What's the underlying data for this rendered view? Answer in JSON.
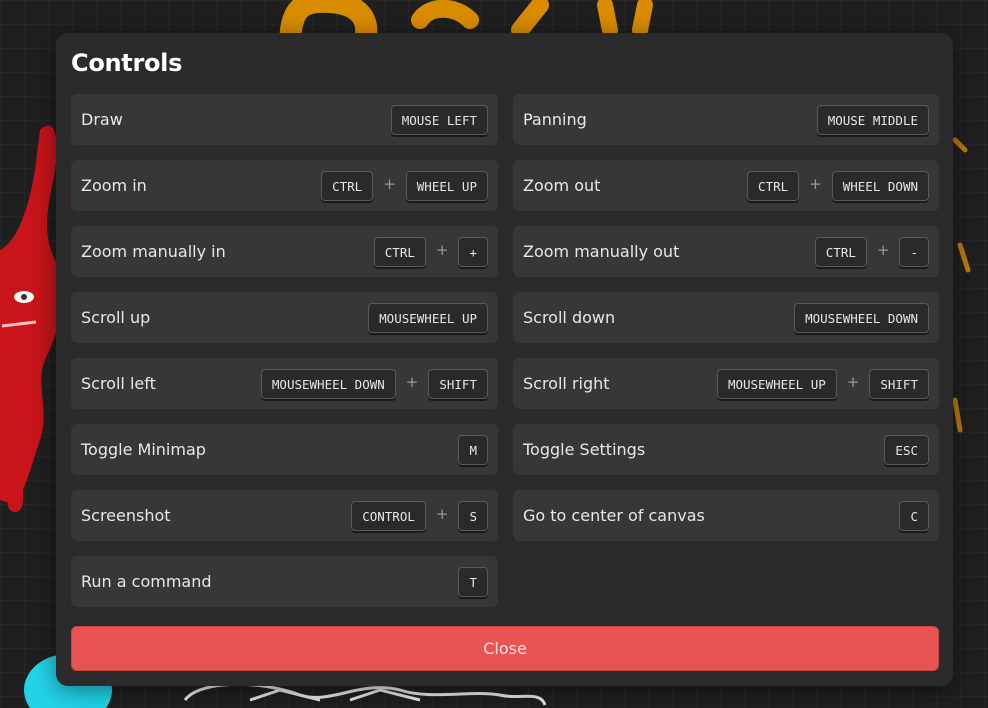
{
  "colors": {
    "modal_bg": "#2b2b2b",
    "row_bg": "#373737",
    "close_button": "#e85454",
    "canvas_orange": "#d98c00",
    "canvas_red": "#c8141a",
    "canvas_cyan": "#22d3e8"
  },
  "modal": {
    "title": "Controls",
    "plus_sign": "+",
    "close_label": "Close"
  },
  "controls": [
    {
      "label": "Draw",
      "keys": [
        "MOUSE LEFT"
      ]
    },
    {
      "label": "Panning",
      "keys": [
        "MOUSE MIDDLE"
      ]
    },
    {
      "label": "Zoom in",
      "keys": [
        "CTRL",
        "WHEEL UP"
      ]
    },
    {
      "label": "Zoom out",
      "keys": [
        "CTRL",
        "WHEEL DOWN"
      ]
    },
    {
      "label": "Zoom manually in",
      "keys": [
        "CTRL",
        "+"
      ]
    },
    {
      "label": "Zoom manually out",
      "keys": [
        "CTRL",
        "-"
      ]
    },
    {
      "label": "Scroll up",
      "keys": [
        "MOUSEWHEEL UP"
      ]
    },
    {
      "label": "Scroll down",
      "keys": [
        "MOUSEWHEEL DOWN"
      ]
    },
    {
      "label": "Scroll left",
      "keys": [
        "MOUSEWHEEL DOWN",
        "SHIFT"
      ]
    },
    {
      "label": "Scroll right",
      "keys": [
        "MOUSEWHEEL UP",
        "SHIFT"
      ]
    },
    {
      "label": "Toggle Minimap",
      "keys": [
        "M"
      ]
    },
    {
      "label": "Toggle Settings",
      "keys": [
        "ESC"
      ]
    },
    {
      "label": "Screenshot",
      "keys": [
        "CONTROL",
        "S"
      ]
    },
    {
      "label": "Go to center of canvas",
      "keys": [
        "C"
      ]
    },
    {
      "label": "Run a command",
      "keys": [
        "T"
      ]
    }
  ]
}
